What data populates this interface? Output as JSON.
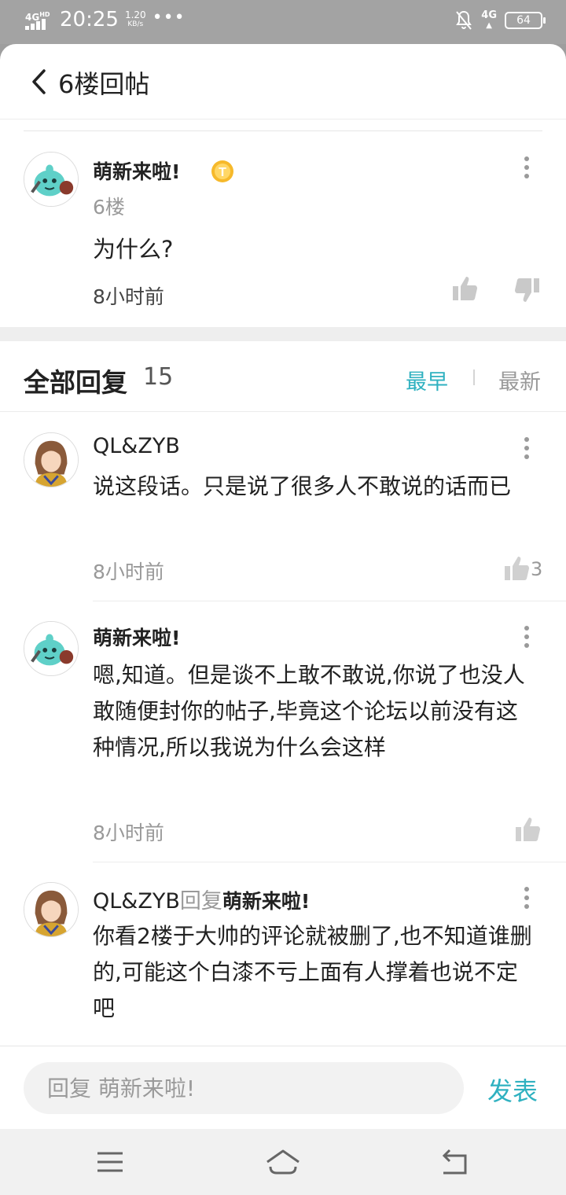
{
  "status_bar": {
    "network_left": "4G",
    "network_hd": "HD",
    "time": "20:25",
    "speed_value": "1.20",
    "speed_unit": "KB/s",
    "more": "•••",
    "network_right": "4G",
    "battery": "64"
  },
  "header": {
    "title": "6楼回帖"
  },
  "main_post": {
    "author": "萌新来啦!",
    "floor": "6楼",
    "body": "为什么?",
    "time": "8小时前"
  },
  "replies_header": {
    "title": "全部回复",
    "count": "15",
    "sort_earliest": "最早",
    "sort_latest": "最新",
    "active_sort_color": "#2fb1c0"
  },
  "replies": [
    {
      "author": "QL&ZYB",
      "body": "说这段话。只是说了很多人不敢说的话而已",
      "time": "8小时前",
      "likes": "3"
    },
    {
      "author": "萌新来啦!",
      "body": "嗯,知道。但是谈不上敢不敢说,你说了也没人敢随便封你的帖子,毕竟这个论坛以前没有这种情况,所以我说为什么会这样",
      "time": "8小时前"
    },
    {
      "author": "QL&ZYB",
      "reply_word": "回复",
      "reply_to": "萌新来啦!",
      "body": "你看2楼于大帅的评论就被删了,也不知道谁删的,可能这个白漆不亏上面有人撑着也说不定吧"
    }
  ],
  "reply_bar": {
    "placeholder": "回复 萌新来啦!",
    "publish": "发表"
  }
}
